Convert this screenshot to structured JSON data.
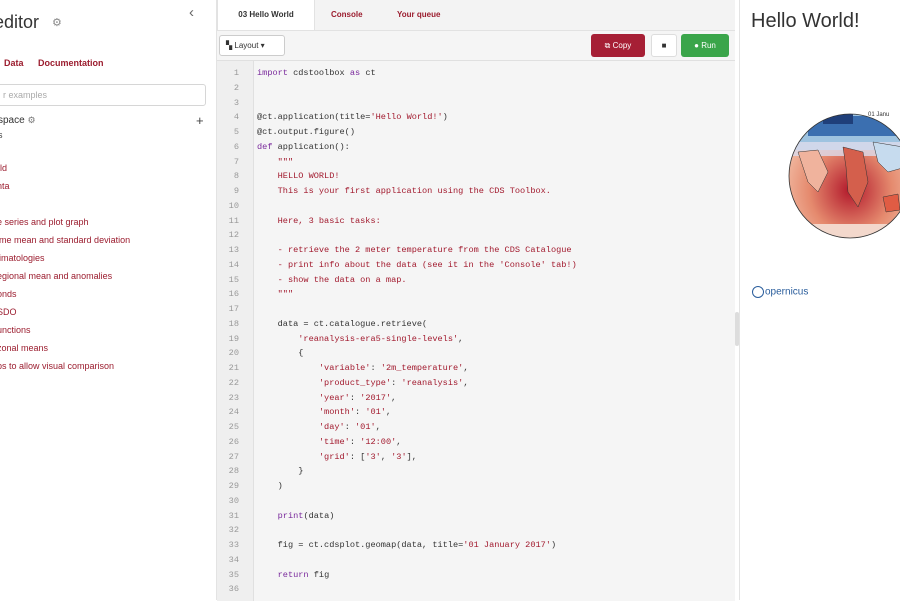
{
  "sidebar": {
    "title": "editor",
    "links": [
      "Data",
      "Documentation"
    ],
    "search_placeholder": "r examples",
    "workspace_label": "space",
    "workspace_sub": "s",
    "items": [
      "rld",
      "nta",
      "e series and plot graph",
      "ime mean and standard deviation",
      "limatologies",
      "egional mean and anomalies",
      "onds",
      "SDO",
      "unctions",
      "zonal means",
      "ps to allow visual comparison"
    ]
  },
  "tabs": [
    "03 Hello World",
    "Console",
    "Your queue"
  ],
  "toolbar": {
    "layout_label": "Layout",
    "copy_label": "Copy",
    "stop_label": "■",
    "run_label": "Run"
  },
  "code_lines": [
    "1|import cdstoolbox as ct",
    "2|",
    "3|",
    "4|@ct.application(title='Hello World!')",
    "5|@ct.output.figure()",
    "6|def application():",
    "7|    \"\"\"",
    "8|    HELLO WORLD!",
    "9|    This is your first application using the CDS Toolbox.",
    "10|",
    "11|    Here, 3 basic tasks:",
    "12|",
    "13|    - retrieve the 2 meter temperature from the CDS Catalogue",
    "14|    - print info about the data (see it in the 'Console' tab!)",
    "15|    - show the data on a map.",
    "16|    \"\"\"",
    "17|",
    "18|    data = ct.catalogue.retrieve(",
    "19|        'reanalysis-era5-single-levels',",
    "20|        {",
    "21|            'variable': '2m_temperature',",
    "22|            'product_type': 'reanalysis',",
    "23|            'year': '2017',",
    "24|            'month': '01',",
    "25|            'day': '01',",
    "26|            'time': '12:00',",
    "27|            'grid': ['3', '3'],",
    "28|        }",
    "29|    )",
    "30|",
    "31|    print(data)",
    "32|",
    "33|    fig = ct.cdsplot.geomap(data, title='01 January 2017')",
    "34|",
    "35|    return fig",
    "36|"
  ],
  "output": {
    "title": "Hello World!",
    "map_title": "01 Janu",
    "logo_text": "opernicus"
  },
  "colors": {
    "accent": "#9b1c2e",
    "copy_button": "#a61f35",
    "run_button": "#3aa54a",
    "keyword": "#7a2a9c",
    "string": "#a21a2e"
  },
  "icons": {
    "collapse": "chevron-left-icon",
    "settings": "gear-icon",
    "add": "plus-icon",
    "layout": "layout-icon",
    "copy": "copy-icon",
    "stop": "stop-icon",
    "run": "play-icon"
  }
}
